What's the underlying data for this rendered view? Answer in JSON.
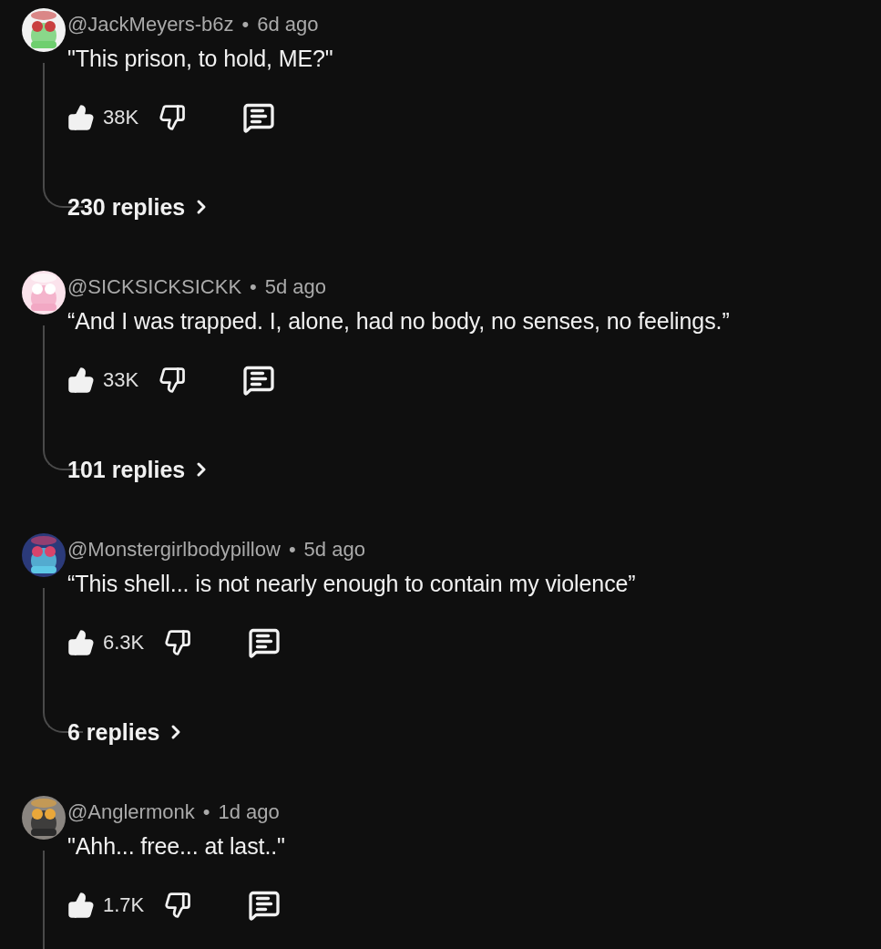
{
  "comments": [
    {
      "author": "@JackMeyers-b6z",
      "separator": "•",
      "time": "6d ago",
      "text": "\"This prison, to hold, ME?\"",
      "likes": "38K",
      "liked": true,
      "replies": "230 replies"
    },
    {
      "author": "@SICKSICKSICKK",
      "separator": "•",
      "time": "5d ago",
      "text": "“And I was trapped. I, alone, had no body, no senses, no feelings.”",
      "likes": "33K",
      "liked": true,
      "replies": "101 replies"
    },
    {
      "author": "@Monstergirlbodypillow",
      "separator": "•",
      "time": "5d ago",
      "text": "“This shell... is not nearly enough to contain my violence”",
      "likes": "6.3K",
      "liked": true,
      "replies": "6 replies"
    },
    {
      "author": "@Anglermonk",
      "separator": "•",
      "time": "1d ago",
      "text": "\"Ahh... free... at last..\"",
      "likes": "1.7K",
      "liked": true
    }
  ]
}
